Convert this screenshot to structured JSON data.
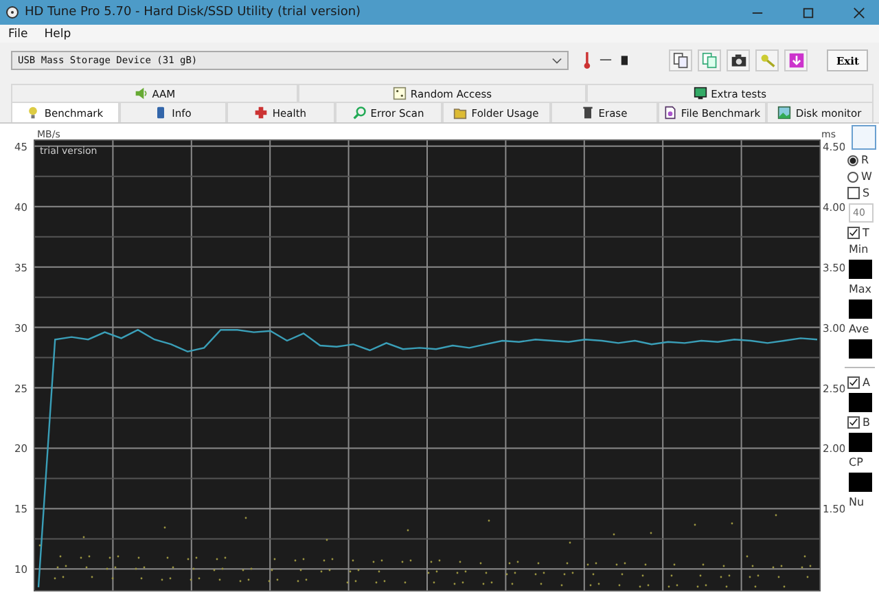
{
  "window": {
    "title": "HD Tune Pro 5.70 - Hard Disk/SSD Utility (trial version)"
  },
  "menu": [
    {
      "label": "File"
    },
    {
      "label": "Help"
    }
  ],
  "toolbar": {
    "drive": "USB Mass Storage Device (31 gB)",
    "temperature": "—",
    "exit": "Exit"
  },
  "tabs_upper": [
    {
      "label": "AAM",
      "selected": false
    },
    {
      "label": "Random Access",
      "selected": false
    },
    {
      "label": "Extra tests",
      "selected": false
    }
  ],
  "tabs_lower": [
    {
      "label": "Benchmark",
      "selected": true
    },
    {
      "label": "Info",
      "selected": false
    },
    {
      "label": "Health",
      "selected": false
    },
    {
      "label": "Error Scan",
      "selected": false
    },
    {
      "label": "Folder Usage",
      "selected": false
    },
    {
      "label": "Erase",
      "selected": false
    },
    {
      "label": "File Benchmark",
      "selected": false
    },
    {
      "label": "Disk monitor",
      "selected": false
    }
  ],
  "benchmark": {
    "watermark_text": "trial version",
    "access_time_axis": {
      "label": "ms",
      "ticks": [
        "4.50",
        "4.00",
        "3.50",
        "3.00",
        "2.50",
        "2.00",
        "1.50"
      ]
    },
    "chart_data": {
      "type": "line",
      "ylabel": "MB/s",
      "grid": true,
      "ylim": [
        8.2,
        45.5
      ],
      "yticks": [
        10,
        15,
        20,
        25,
        30,
        35,
        40,
        45
      ],
      "series": [
        {
          "color": "#3a9fb8",
          "values": [
            8.5,
            29,
            29.2,
            29.0,
            29.6,
            29.1,
            29.8,
            29.0,
            28.6,
            28.0,
            28.3,
            29.8,
            29.8,
            29.6,
            29.7,
            28.9,
            29.5,
            28.5,
            28.4,
            28.6,
            28.1,
            28.7,
            28.2,
            28.3,
            28.2,
            28.5,
            28.3,
            28.6,
            28.9,
            28.8,
            29.0,
            28.9,
            28.8,
            29.0,
            28.9,
            28.7,
            28.9,
            28.6,
            28.8,
            28.7,
            28.9,
            28.8,
            29.0,
            28.9,
            28.7,
            28.9,
            29.1,
            29.0
          ]
        }
      ]
    }
  },
  "right_panel": [
    {
      "kind": "button"
    },
    {
      "kind": "radio",
      "label": "R",
      "selected": true
    },
    {
      "kind": "radio",
      "label": "W",
      "selected": false
    },
    {
      "kind": "checkbox",
      "label": "S",
      "checked": false
    },
    {
      "kind": "field",
      "value": "40"
    },
    {
      "kind": "checkbox",
      "label": "T",
      "checked": true
    },
    {
      "kind": "label",
      "label": "Min"
    },
    {
      "kind": "swatch"
    },
    {
      "kind": "label",
      "label": "Max"
    },
    {
      "kind": "swatch"
    },
    {
      "kind": "label",
      "label": "Ave"
    },
    {
      "kind": "swatch"
    },
    {
      "kind": "divider"
    },
    {
      "kind": "checkbox",
      "label": "A",
      "checked": true
    },
    {
      "kind": "swatch"
    },
    {
      "kind": "checkbox",
      "label": "B",
      "checked": true
    },
    {
      "kind": "swatch"
    },
    {
      "kind": "label",
      "label": "CP"
    },
    {
      "kind": "swatch"
    },
    {
      "kind": "label",
      "label": "Nu"
    }
  ]
}
